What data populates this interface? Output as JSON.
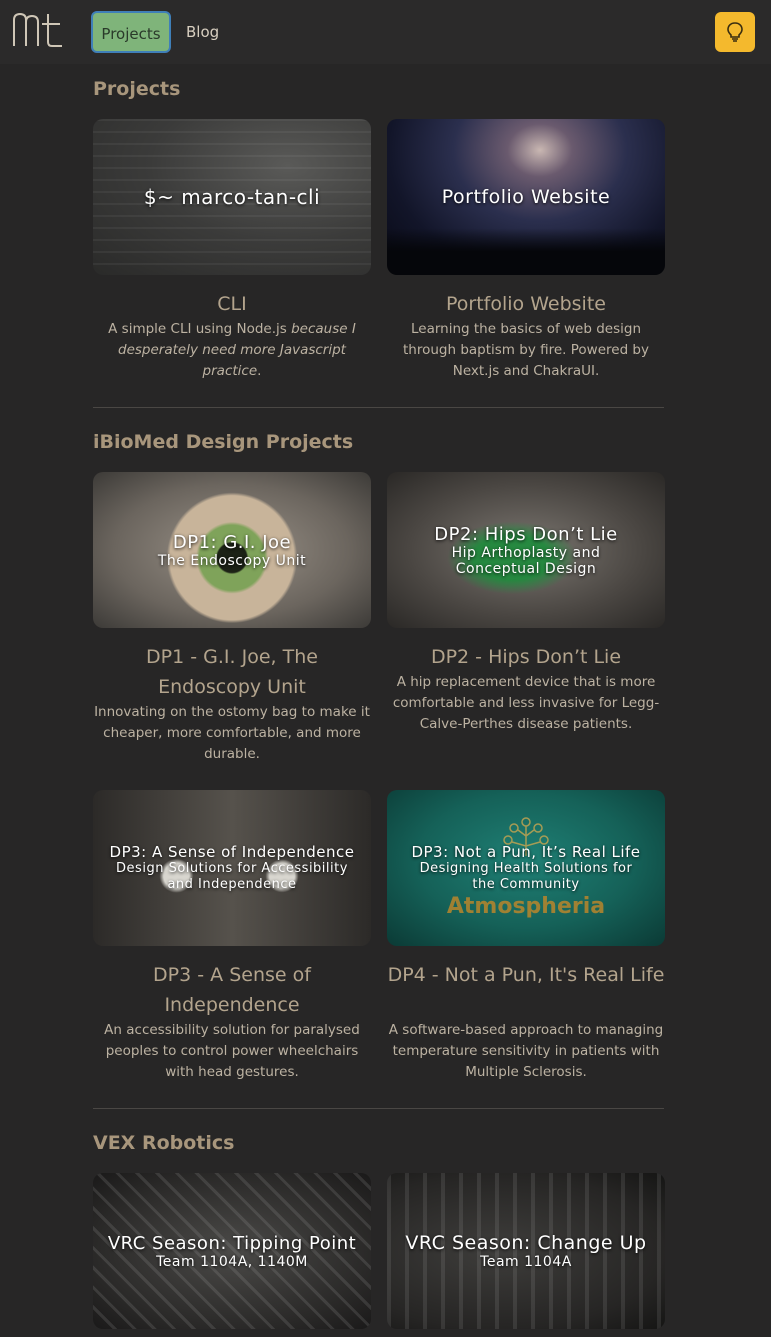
{
  "nav": {
    "logo_text": "mt",
    "projects_label": "Projects",
    "blog_label": "Blog"
  },
  "sections": [
    {
      "title": "Projects",
      "cards": [
        {
          "thumb_title": "$~ marco-tan-cli",
          "thumb_subtitle": "",
          "title": "CLI",
          "desc_plain": "A simple CLI using Node.js ",
          "desc_em": "because I desperately need more Javascript practice",
          "desc_end": "."
        },
        {
          "thumb_title": "Portfolio Website",
          "thumb_subtitle": "",
          "title": "Portfolio Website",
          "desc": "Learning the basics of web design through baptism by fire. Powered by Next.js and ChakraUI."
        }
      ]
    },
    {
      "title": "iBioMed Design Projects",
      "cards": [
        {
          "thumb_title": "DP1: G.I. Joe",
          "thumb_subtitle": "The Endoscopy Unit",
          "title": "DP1 - G.I. Joe, The Endoscopy Unit",
          "desc": "Innovating on the ostomy bag to make it cheaper, more comfortable, and more durable."
        },
        {
          "thumb_title": "DP2: Hips Don’t Lie",
          "thumb_subtitle": "Hip Arthoplasty and Conceptual Design",
          "title": "DP2 - Hips Don’t Lie",
          "desc": "A hip replacement device that is more comfortable and less invasive for Legg-Calve-Perthes disease patients."
        },
        {
          "thumb_title": "DP3: A Sense of Independence",
          "thumb_subtitle": "Design Solutions for Accessibility and Independence",
          "title": "DP3 - A Sense of Independence",
          "desc": "An accessibility solution for paralysed peoples to control power wheelchairs with head gestures."
        },
        {
          "thumb_title": "DP3: Not a Pun, It’s Real Life",
          "thumb_subtitle": "Designing Health Solutions for the Community",
          "thumb_brand": "Atmospheria",
          "title": "DP4 - Not a Pun, It's Real Life",
          "desc": "A software-based approach to managing temperature sensitivity in patients with Multiple Sclerosis."
        }
      ]
    },
    {
      "title": "VEX Robotics",
      "cards": [
        {
          "thumb_title": "VRC Season: Tipping Point",
          "thumb_subtitle": "Team 1104A, 1140M"
        },
        {
          "thumb_title": "VRC Season: Change Up",
          "thumb_subtitle": "Team 1104A"
        }
      ]
    }
  ]
}
